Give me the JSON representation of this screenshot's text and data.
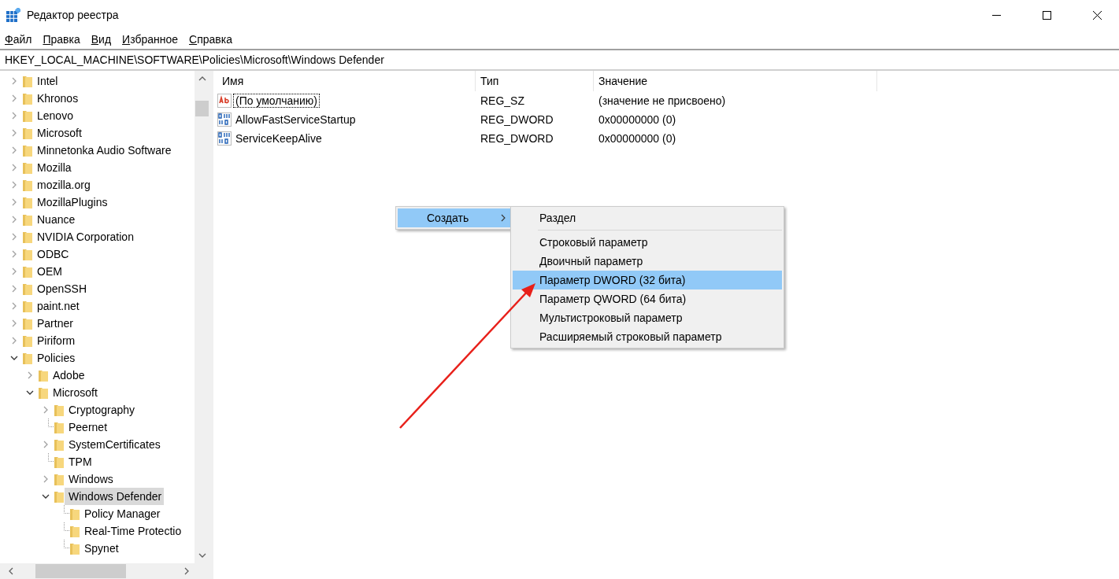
{
  "window": {
    "title": "Редактор реестра"
  },
  "menu": [
    "Файл",
    "Правка",
    "Вид",
    "Избранное",
    "Справка"
  ],
  "address": "HKEY_LOCAL_MACHINE\\SOFTWARE\\Policies\\Microsoft\\Windows Defender",
  "tree": [
    {
      "name": "Intel",
      "expandable": true,
      "expanded": false,
      "selected": false
    },
    {
      "name": "Khronos",
      "expandable": true,
      "expanded": false,
      "selected": false
    },
    {
      "name": "Lenovo",
      "expandable": true,
      "expanded": false,
      "selected": false
    },
    {
      "name": "Microsoft",
      "expandable": true,
      "expanded": false,
      "selected": false
    },
    {
      "name": "Minnetonka Audio Software",
      "expandable": true,
      "expanded": false,
      "selected": false
    },
    {
      "name": "Mozilla",
      "expandable": true,
      "expanded": false,
      "selected": false
    },
    {
      "name": "mozilla.org",
      "expandable": true,
      "expanded": false,
      "selected": false
    },
    {
      "name": "MozillaPlugins",
      "expandable": true,
      "expanded": false,
      "selected": false
    },
    {
      "name": "Nuance",
      "expandable": true,
      "expanded": false,
      "selected": false
    },
    {
      "name": "NVIDIA Corporation",
      "expandable": true,
      "expanded": false,
      "selected": false
    },
    {
      "name": "ODBC",
      "expandable": true,
      "expanded": false,
      "selected": false
    },
    {
      "name": "OEM",
      "expandable": true,
      "expanded": false,
      "selected": false
    },
    {
      "name": "OpenSSH",
      "expandable": true,
      "expanded": false,
      "selected": false
    },
    {
      "name": "paint.net",
      "expandable": true,
      "expanded": false,
      "selected": false
    },
    {
      "name": "Partner",
      "expandable": true,
      "expanded": false,
      "selected": false
    },
    {
      "name": "Piriform",
      "expandable": true,
      "expanded": false,
      "selected": false
    },
    {
      "name": "Policies",
      "expandable": true,
      "expanded": true,
      "selected": false,
      "children": [
        {
          "name": "Adobe",
          "expandable": true,
          "expanded": false,
          "selected": false
        },
        {
          "name": "Microsoft",
          "expandable": true,
          "expanded": true,
          "selected": false,
          "children": [
            {
              "name": "Cryptography",
              "expandable": true,
              "expanded": false,
              "selected": false
            },
            {
              "name": "Peernet",
              "expandable": false,
              "expanded": false,
              "selected": false
            },
            {
              "name": "SystemCertificates",
              "expandable": true,
              "expanded": false,
              "selected": false
            },
            {
              "name": "TPM",
              "expandable": false,
              "expanded": false,
              "selected": false
            },
            {
              "name": "Windows",
              "expandable": true,
              "expanded": false,
              "selected": false
            },
            {
              "name": "Windows Defender",
              "expandable": true,
              "expanded": true,
              "selected": true,
              "children": [
                {
                  "name": "Policy Manager",
                  "expandable": false,
                  "expanded": false,
                  "selected": false
                },
                {
                  "name": "Real-Time Protectio",
                  "expandable": false,
                  "expanded": false,
                  "selected": false
                },
                {
                  "name": "Spynet",
                  "expandable": false,
                  "expanded": false,
                  "selected": false
                }
              ]
            }
          ]
        }
      ]
    }
  ],
  "list": {
    "columns": [
      "Имя",
      "Тип",
      "Значение"
    ],
    "rows": [
      {
        "kind": "string",
        "name": "(По умолчанию)",
        "type": "REG_SZ",
        "value": "(значение не присвоено)",
        "focused": true
      },
      {
        "kind": "binary",
        "name": "AllowFastServiceStartup",
        "type": "REG_DWORD",
        "value": "0x00000000 (0)",
        "focused": false
      },
      {
        "kind": "binary",
        "name": "ServiceKeepAlive",
        "type": "REG_DWORD",
        "value": "0x00000000 (0)",
        "focused": false
      }
    ]
  },
  "context_menu": {
    "items": [
      {
        "label": "Создать",
        "selected": true
      }
    ]
  },
  "submenu": {
    "groups": [
      [
        {
          "label": "Раздел",
          "selected": false
        }
      ],
      [
        {
          "label": "Строковый параметр",
          "selected": false
        },
        {
          "label": "Двоичный параметр",
          "selected": false
        },
        {
          "label": "Параметр DWORD (32 бита)",
          "selected": true
        },
        {
          "label": "Параметр QWORD (64 бита)",
          "selected": false
        },
        {
          "label": "Мультистроковый параметр",
          "selected": false
        },
        {
          "label": "Расширяемый строковый параметр",
          "selected": false
        }
      ]
    ]
  }
}
